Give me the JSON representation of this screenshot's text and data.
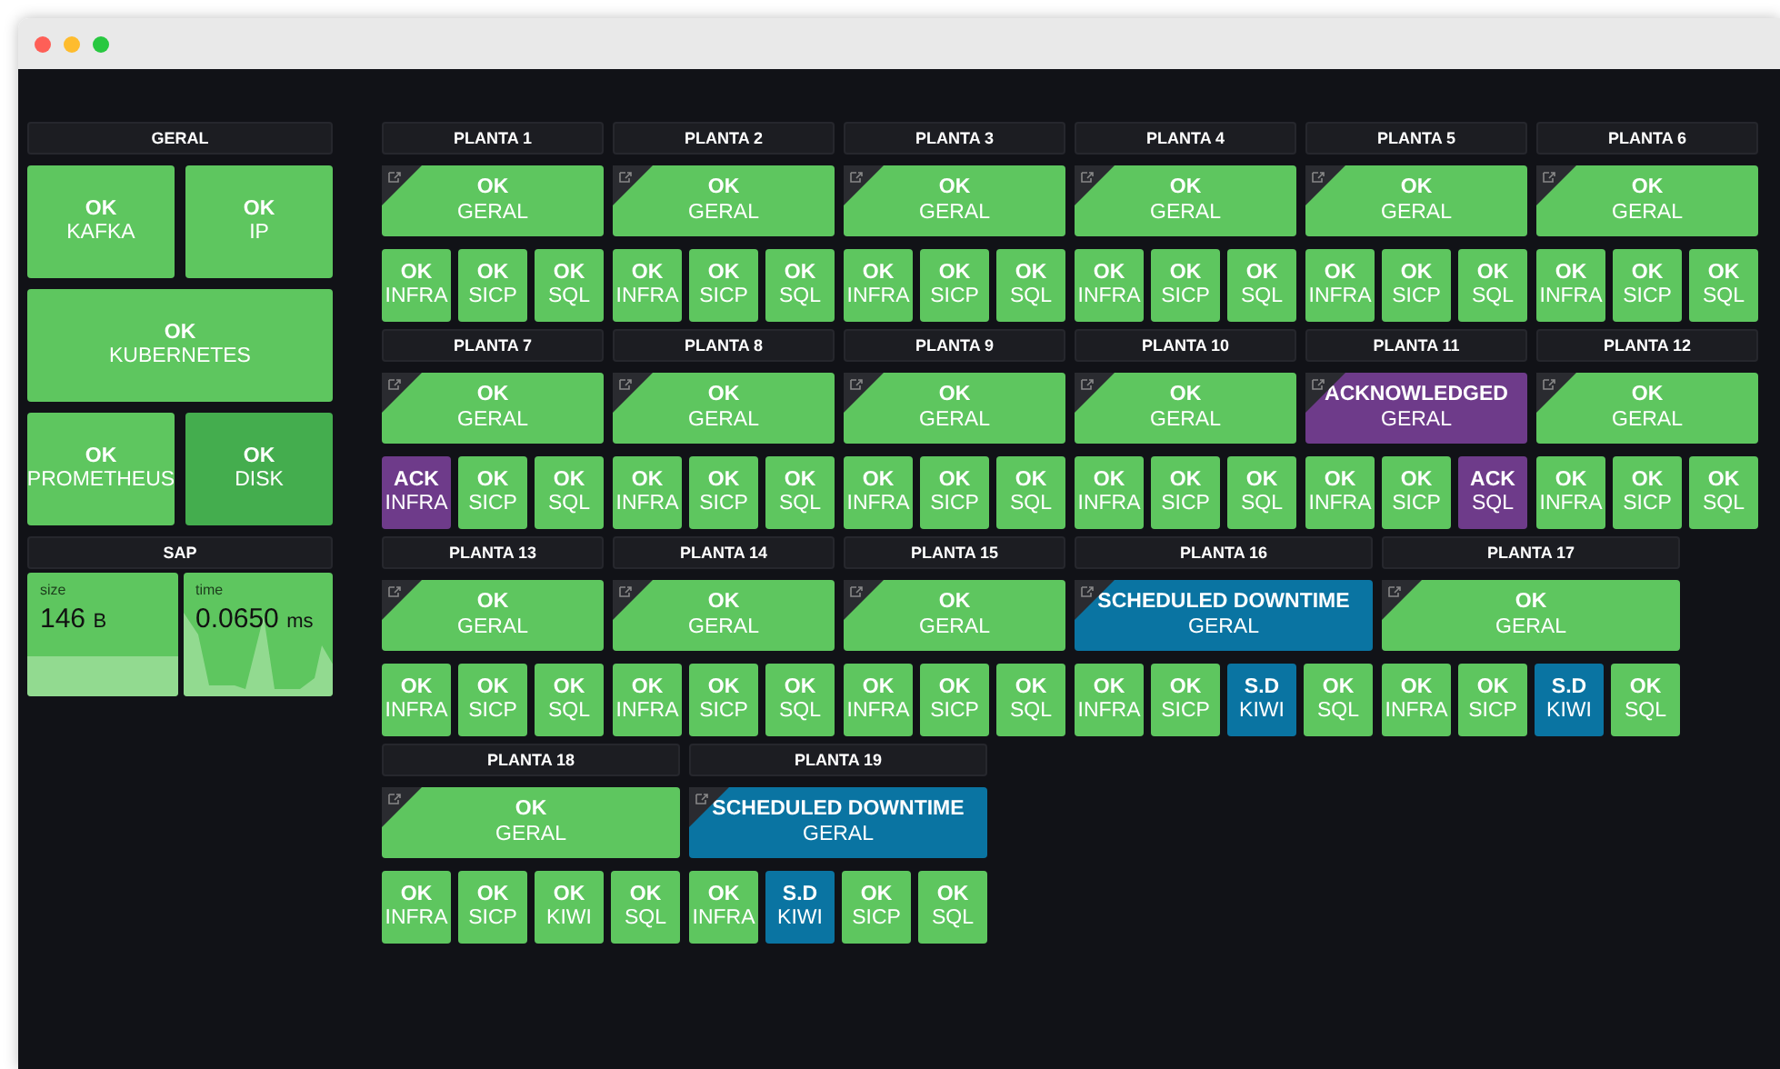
{
  "geral": {
    "title": "GERAL",
    "tiles": [
      {
        "status": "OK",
        "name": "KAFKA",
        "color": "#5ec65f",
        "wide": false
      },
      {
        "status": "OK",
        "name": "IP",
        "color": "#5ec65f",
        "wide": false
      },
      {
        "status": "OK",
        "name": "KUBERNETES",
        "color": "#5ec65f",
        "wide": true
      },
      {
        "status": "OK",
        "name": "PROMETHEUS",
        "color": "#5ec65f",
        "wide": false
      },
      {
        "status": "OK",
        "name": "DISK",
        "color": "#44ad4e",
        "wide": false
      }
    ]
  },
  "sap": {
    "title": "SAP",
    "stats": [
      {
        "kind": "area",
        "label": "size",
        "value": "146",
        "unit": "B"
      },
      {
        "kind": "sparkline",
        "label": "time",
        "value": "0.0650",
        "unit": "ms"
      }
    ]
  },
  "rows": [
    [
      {
        "title": "PLANTA 1",
        "geral": {
          "status": "OK",
          "name": "GERAL",
          "color": "#5ec65f"
        },
        "checks": [
          {
            "status": "OK",
            "name": "INFRA",
            "color": "#5ec65f"
          },
          {
            "status": "OK",
            "name": "SICP",
            "color": "#5ec65f"
          },
          {
            "status": "OK",
            "name": "SQL",
            "color": "#5ec65f"
          }
        ]
      },
      {
        "title": "PLANTA 2",
        "geral": {
          "status": "OK",
          "name": "GERAL",
          "color": "#5ec65f"
        },
        "checks": [
          {
            "status": "OK",
            "name": "INFRA",
            "color": "#5ec65f"
          },
          {
            "status": "OK",
            "name": "SICP",
            "color": "#5ec65f"
          },
          {
            "status": "OK",
            "name": "SQL",
            "color": "#5ec65f"
          }
        ]
      },
      {
        "title": "PLANTA 3",
        "geral": {
          "status": "OK",
          "name": "GERAL",
          "color": "#5ec65f"
        },
        "checks": [
          {
            "status": "OK",
            "name": "INFRA",
            "color": "#5ec65f"
          },
          {
            "status": "OK",
            "name": "SICP",
            "color": "#5ec65f"
          },
          {
            "status": "OK",
            "name": "SQL",
            "color": "#5ec65f"
          }
        ]
      },
      {
        "title": "PLANTA 4",
        "geral": {
          "status": "OK",
          "name": "GERAL",
          "color": "#5ec65f"
        },
        "checks": [
          {
            "status": "OK",
            "name": "INFRA",
            "color": "#5ec65f"
          },
          {
            "status": "OK",
            "name": "SICP",
            "color": "#5ec65f"
          },
          {
            "status": "OK",
            "name": "SQL",
            "color": "#5ec65f"
          }
        ]
      },
      {
        "title": "PLANTA 5",
        "geral": {
          "status": "OK",
          "name": "GERAL",
          "color": "#5ec65f"
        },
        "checks": [
          {
            "status": "OK",
            "name": "INFRA",
            "color": "#5ec65f"
          },
          {
            "status": "OK",
            "name": "SICP",
            "color": "#5ec65f"
          },
          {
            "status": "OK",
            "name": "SQL",
            "color": "#5ec65f"
          }
        ]
      },
      {
        "title": "PLANTA 6",
        "geral": {
          "status": "OK",
          "name": "GERAL",
          "color": "#5ec65f"
        },
        "checks": [
          {
            "status": "OK",
            "name": "INFRA",
            "color": "#5ec65f"
          },
          {
            "status": "OK",
            "name": "SICP",
            "color": "#5ec65f"
          },
          {
            "status": "OK",
            "name": "SQL",
            "color": "#5ec65f"
          }
        ]
      }
    ],
    [
      {
        "title": "PLANTA 7",
        "geral": {
          "status": "OK",
          "name": "GERAL",
          "color": "#5ec65f"
        },
        "checks": [
          {
            "status": "ACK",
            "name": "INFRA",
            "color": "#6e3b8a"
          },
          {
            "status": "OK",
            "name": "SICP",
            "color": "#5ec65f"
          },
          {
            "status": "OK",
            "name": "SQL",
            "color": "#5ec65f"
          }
        ]
      },
      {
        "title": "PLANTA 8",
        "geral": {
          "status": "OK",
          "name": "GERAL",
          "color": "#5ec65f"
        },
        "checks": [
          {
            "status": "OK",
            "name": "INFRA",
            "color": "#5ec65f"
          },
          {
            "status": "OK",
            "name": "SICP",
            "color": "#5ec65f"
          },
          {
            "status": "OK",
            "name": "SQL",
            "color": "#5ec65f"
          }
        ]
      },
      {
        "title": "PLANTA 9",
        "geral": {
          "status": "OK",
          "name": "GERAL",
          "color": "#5ec65f"
        },
        "checks": [
          {
            "status": "OK",
            "name": "INFRA",
            "color": "#5ec65f"
          },
          {
            "status": "OK",
            "name": "SICP",
            "color": "#5ec65f"
          },
          {
            "status": "OK",
            "name": "SQL",
            "color": "#5ec65f"
          }
        ]
      },
      {
        "title": "PLANTA 10",
        "geral": {
          "status": "OK",
          "name": "GERAL",
          "color": "#5ec65f"
        },
        "checks": [
          {
            "status": "OK",
            "name": "INFRA",
            "color": "#5ec65f"
          },
          {
            "status": "OK",
            "name": "SICP",
            "color": "#5ec65f"
          },
          {
            "status": "OK",
            "name": "SQL",
            "color": "#5ec65f"
          }
        ]
      },
      {
        "title": "PLANTA 11",
        "geral": {
          "status": "ACKNOWLEDGED",
          "name": "GERAL",
          "color": "#6e3b8a"
        },
        "checks": [
          {
            "status": "OK",
            "name": "INFRA",
            "color": "#5ec65f"
          },
          {
            "status": "OK",
            "name": "SICP",
            "color": "#5ec65f"
          },
          {
            "status": "ACK",
            "name": "SQL",
            "color": "#6e3b8a"
          }
        ]
      },
      {
        "title": "PLANTA 12",
        "geral": {
          "status": "OK",
          "name": "GERAL",
          "color": "#5ec65f"
        },
        "checks": [
          {
            "status": "OK",
            "name": "INFRA",
            "color": "#5ec65f"
          },
          {
            "status": "OK",
            "name": "SICP",
            "color": "#5ec65f"
          },
          {
            "status": "OK",
            "name": "SQL",
            "color": "#5ec65f"
          }
        ]
      }
    ],
    [
      {
        "title": "PLANTA 13",
        "geral": {
          "status": "OK",
          "name": "GERAL",
          "color": "#5ec65f"
        },
        "checks": [
          {
            "status": "OK",
            "name": "INFRA",
            "color": "#5ec65f"
          },
          {
            "status": "OK",
            "name": "SICP",
            "color": "#5ec65f"
          },
          {
            "status": "OK",
            "name": "SQL",
            "color": "#5ec65f"
          }
        ]
      },
      {
        "title": "PLANTA 14",
        "geral": {
          "status": "OK",
          "name": "GERAL",
          "color": "#5ec65f"
        },
        "checks": [
          {
            "status": "OK",
            "name": "INFRA",
            "color": "#5ec65f"
          },
          {
            "status": "OK",
            "name": "SICP",
            "color": "#5ec65f"
          },
          {
            "status": "OK",
            "name": "SQL",
            "color": "#5ec65f"
          }
        ]
      },
      {
        "title": "PLANTA 15",
        "geral": {
          "status": "OK",
          "name": "GERAL",
          "color": "#5ec65f"
        },
        "checks": [
          {
            "status": "OK",
            "name": "INFRA",
            "color": "#5ec65f"
          },
          {
            "status": "OK",
            "name": "SICP",
            "color": "#5ec65f"
          },
          {
            "status": "OK",
            "name": "SQL",
            "color": "#5ec65f"
          }
        ]
      },
      {
        "title": "PLANTA 16",
        "geral": {
          "status": "SCHEDULED DOWNTIME",
          "name": "GERAL",
          "color": "#0a74a2"
        },
        "checks": [
          {
            "status": "OK",
            "name": "INFRA",
            "color": "#5ec65f"
          },
          {
            "status": "OK",
            "name": "SICP",
            "color": "#5ec65f"
          },
          {
            "status": "S.D",
            "name": "KIWI",
            "color": "#0a74a2"
          },
          {
            "status": "OK",
            "name": "SQL",
            "color": "#5ec65f"
          }
        ]
      },
      {
        "title": "PLANTA 17",
        "geral": {
          "status": "OK",
          "name": "GERAL",
          "color": "#5ec65f"
        },
        "checks": [
          {
            "status": "OK",
            "name": "INFRA",
            "color": "#5ec65f"
          },
          {
            "status": "OK",
            "name": "SICP",
            "color": "#5ec65f"
          },
          {
            "status": "S.D",
            "name": "KIWI",
            "color": "#0a74a2"
          },
          {
            "status": "OK",
            "name": "SQL",
            "color": "#5ec65f"
          }
        ]
      }
    ],
    [
      {
        "title": "PLANTA 18",
        "geral": {
          "status": "OK",
          "name": "GERAL",
          "color": "#5ec65f"
        },
        "checks": [
          {
            "status": "OK",
            "name": "INFRA",
            "color": "#5ec65f"
          },
          {
            "status": "OK",
            "name": "SICP",
            "color": "#5ec65f"
          },
          {
            "status": "OK",
            "name": "KIWI",
            "color": "#5ec65f"
          },
          {
            "status": "OK",
            "name": "SQL",
            "color": "#5ec65f"
          }
        ]
      },
      {
        "title": "PLANTA 19",
        "geral": {
          "status": "SCHEDULED DOWNTIME",
          "name": "GERAL",
          "color": "#0a74a2"
        },
        "checks": [
          {
            "status": "OK",
            "name": "INFRA",
            "color": "#5ec65f"
          },
          {
            "status": "S.D",
            "name": "KIWI",
            "color": "#0a74a2"
          },
          {
            "status": "OK",
            "name": "SICP",
            "color": "#5ec65f"
          },
          {
            "status": "OK",
            "name": "SQL",
            "color": "#5ec65f"
          }
        ]
      }
    ]
  ]
}
